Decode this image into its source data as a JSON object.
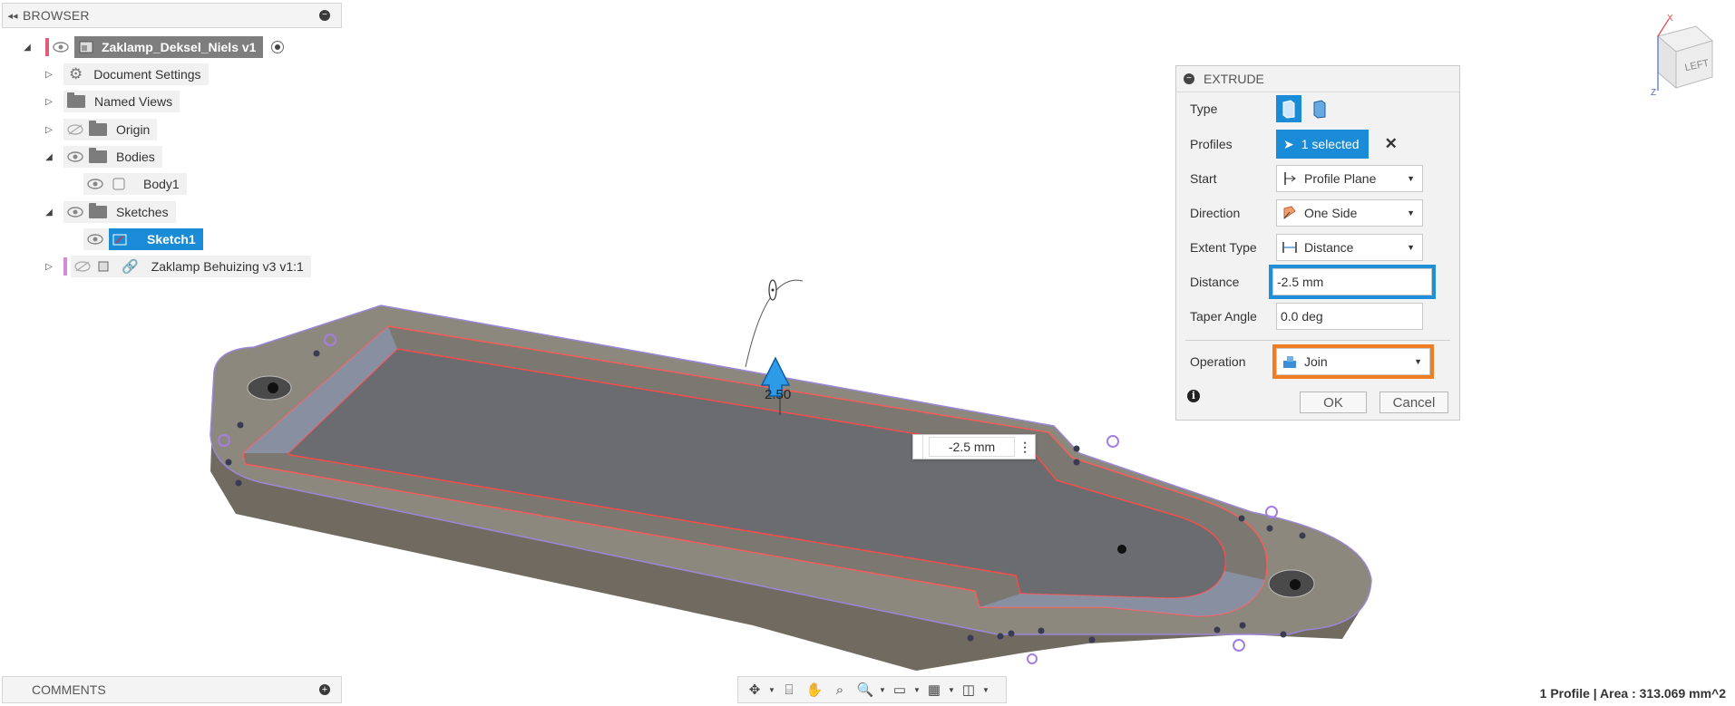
{
  "browser": {
    "title": "BROWSER",
    "items": [
      {
        "label": "Zaklamp_Deksel_Niels v1"
      },
      {
        "label": "Document Settings"
      },
      {
        "label": "Named Views"
      },
      {
        "label": "Origin"
      },
      {
        "label": "Bodies"
      },
      {
        "label": "Body1"
      },
      {
        "label": "Sketches"
      },
      {
        "label": "Sketch1"
      },
      {
        "label": "Zaklamp Behuizing v3 v1:1"
      }
    ]
  },
  "comments": {
    "title": "COMMENTS"
  },
  "extrude": {
    "title": "EXTRUDE",
    "type_label": "Type",
    "profiles_label": "Profiles",
    "profiles_value": "1 selected",
    "start_label": "Start",
    "start_value": "Profile Plane",
    "direction_label": "Direction",
    "direction_value": "One Side",
    "extent_label": "Extent Type",
    "extent_value": "Distance",
    "distance_label": "Distance",
    "distance_value": "-2.5 mm",
    "taper_label": "Taper Angle",
    "taper_value": "0.0 deg",
    "operation_label": "Operation",
    "operation_value": "Join",
    "ok": "OK",
    "cancel": "Cancel",
    "info_icon": "info-icon"
  },
  "canvas": {
    "dimension_value": "-2.5 mm",
    "drag_value": "2.50"
  },
  "viewcube": {
    "face": "LEFT",
    "x": "X",
    "z": "Z"
  },
  "status": {
    "text": "1 Profile | Area : 313.069 mm^2"
  },
  "colors": {
    "accent": "#1a8bd6",
    "highlight_blue": "#1e8fd8",
    "highlight_orange": "#f07d22",
    "profile_red": "#ff4a4a"
  }
}
